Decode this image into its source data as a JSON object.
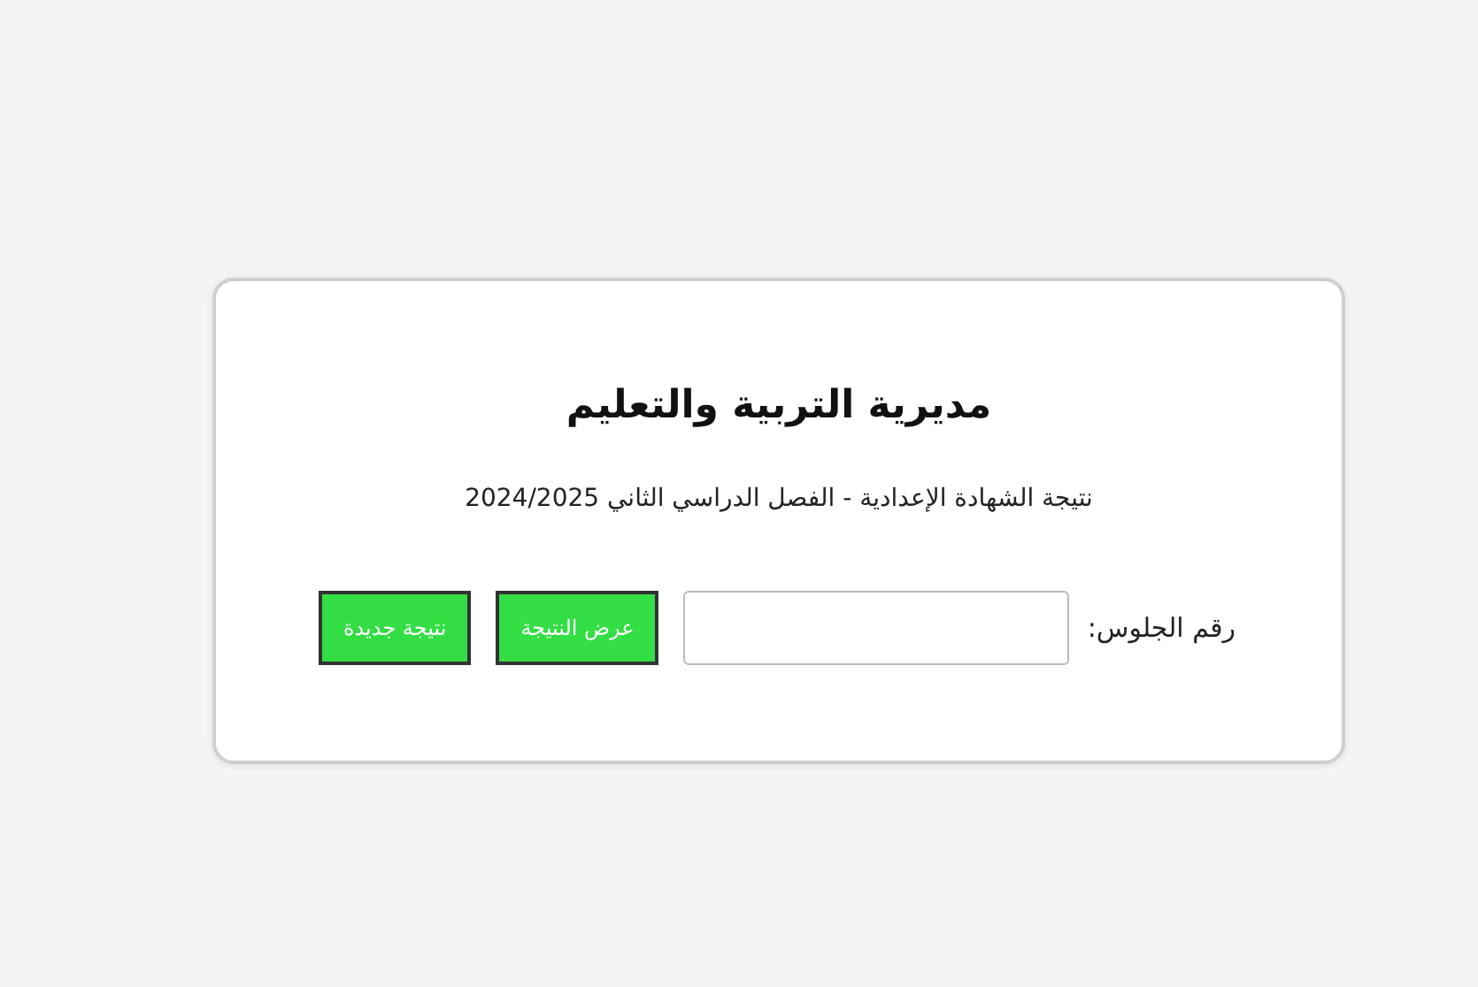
{
  "card": {
    "title": "مديرية التربية والتعليم",
    "subtitle": "نتيجة الشهادة الإعدادية - الفصل الدراسي الثاني 2024/2025"
  },
  "form": {
    "label": "رقم الجلوس:",
    "buttons": [
      "عرض النتيجة",
      "نتيجة جديدة"
    ]
  }
}
